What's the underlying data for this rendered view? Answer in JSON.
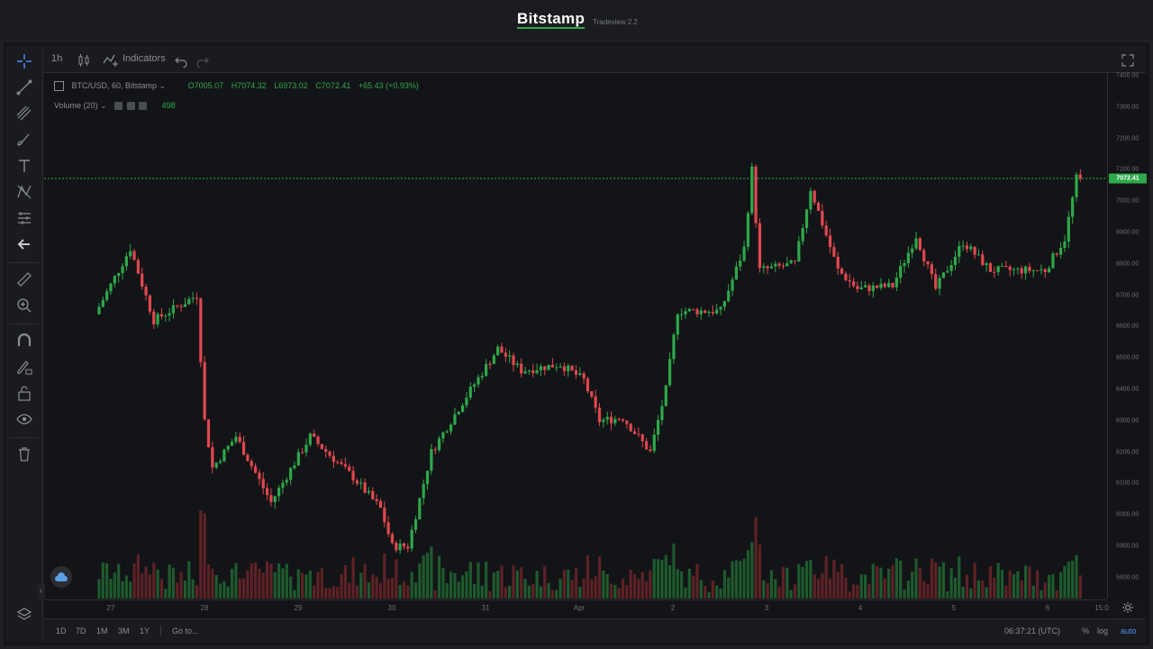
{
  "header": {
    "brand": "Bitstamp",
    "version": "Tradeview 2.2"
  },
  "toolbar": {
    "interval": "1h",
    "indicators_label": "Indicators"
  },
  "legend": {
    "symbol": "BTC/USD, 60, Bitstamp",
    "open": "O7005.07",
    "high": "H7074.32",
    "low": "L6973.02",
    "close": "C7072.41",
    "change": "+65.43 (+0.93%)"
  },
  "volume_legend": {
    "label": "Volume (20)",
    "value": "498"
  },
  "bottom": {
    "ranges": [
      "1D",
      "7D",
      "1M",
      "3M",
      "1Y"
    ],
    "goto": "Go to...",
    "clock": "06:37:21 (UTC)",
    "percent": "%",
    "log": "log",
    "auto": "auto"
  },
  "colors": {
    "up": "#2ea84a",
    "down": "#e0484f",
    "accent": "#2ea84a",
    "auto": "#4f8ff7"
  },
  "icons": [
    "crosshair-icon",
    "trend-line-icon",
    "fib-icon",
    "brush-icon",
    "text-icon",
    "pattern-icon",
    "projection-icon",
    "back-arrow-icon",
    "ruler-icon",
    "zoom-icon",
    "magnet-icon",
    "lock-draw-icon",
    "lock-icon",
    "eye-icon",
    "trash-icon",
    "layers-icon"
  ],
  "chart_data": {
    "type": "candlestick",
    "symbol": "BTC/USD",
    "interval": "60",
    "exchange": "Bitstamp",
    "ylim": [
      5720,
      7420
    ],
    "price_ticks": [
      7400,
      7300,
      7200,
      7100,
      7000,
      6900,
      6800,
      6700,
      6600,
      6500,
      6400,
      6300,
      6200,
      6100,
      6000,
      5900,
      5800
    ],
    "price_tick_labels": [
      "7400.00",
      "7300.00",
      "7200.00",
      "7100.00",
      "7000.00",
      "6900.00",
      "6800.00",
      "6700.00",
      "6600.00",
      "6500.00",
      "6400.00",
      "6300.00",
      "6200.00",
      "6100.00",
      "6000.00",
      "5900.00",
      "5800.00"
    ],
    "last_price": 7072.41,
    "last_price_label": "7072.41",
    "time_labels": [
      "27",
      "28",
      "29",
      "30",
      "31",
      "Apr",
      "2",
      "3",
      "4",
      "5",
      "6",
      "15:0"
    ],
    "key_points": [
      {
        "date": "Mar 26 21:00",
        "price": 6640
      },
      {
        "date": "Mar 27 06:00",
        "price": 6850
      },
      {
        "date": "Mar 27 12:00",
        "price": 6620
      },
      {
        "date": "Mar 27 23:00",
        "price": 6700
      },
      {
        "date": "Mar 28 01:00",
        "price": 6300
      },
      {
        "date": "Mar 28 03:00",
        "price": 6150
      },
      {
        "date": "Mar 28 09:00",
        "price": 6250
      },
      {
        "date": "Mar 28 18:00",
        "price": 6040
      },
      {
        "date": "Mar 29 04:00",
        "price": 6250
      },
      {
        "date": "Mar 29 15:00",
        "price": 6120
      },
      {
        "date": "Mar 29 22:00",
        "price": 6020
      },
      {
        "date": "Mar 30 01:00",
        "price": 5900
      },
      {
        "date": "Mar 30 05:00",
        "price": 5900
      },
      {
        "date": "Mar 30 11:00",
        "price": 6200
      },
      {
        "date": "Mar 30 19:00",
        "price": 6360
      },
      {
        "date": "Mar 31 04:00",
        "price": 6530
      },
      {
        "date": "Mar 31 10:00",
        "price": 6460
      },
      {
        "date": "Mar 31 20:00",
        "price": 6480
      },
      {
        "date": "Apr 1 02:00",
        "price": 6430
      },
      {
        "date": "Apr 1 06:00",
        "price": 6300
      },
      {
        "date": "Apr 1 12:00",
        "price": 6310
      },
      {
        "date": "Apr 1 19:00",
        "price": 6200
      },
      {
        "date": "Apr 1 23:00",
        "price": 6400
      },
      {
        "date": "Apr 2 02:00",
        "price": 6650
      },
      {
        "date": "Apr 2 13:00",
        "price": 6650
      },
      {
        "date": "Apr 2 19:00",
        "price": 6850
      },
      {
        "date": "Apr 2 21:00",
        "price": 7100
      },
      {
        "date": "Apr 2 23:00",
        "price": 6780
      },
      {
        "date": "Apr 3 08:00",
        "price": 6800
      },
      {
        "date": "Apr 3 12:00",
        "price": 7040
      },
      {
        "date": "Apr 3 19:00",
        "price": 6780
      },
      {
        "date": "Apr 4 00:00",
        "price": 6720
      },
      {
        "date": "Apr 4 09:00",
        "price": 6730
      },
      {
        "date": "Apr 4 15:00",
        "price": 6890
      },
      {
        "date": "Apr 4 20:00",
        "price": 6720
      },
      {
        "date": "Apr 5 03:00",
        "price": 6870
      },
      {
        "date": "Apr 5 10:00",
        "price": 6780
      },
      {
        "date": "Apr 5 18:00",
        "price": 6780
      },
      {
        "date": "Apr 6 00:00",
        "price": 6780
      },
      {
        "date": "Apr 6 05:00",
        "price": 6880
      },
      {
        "date": "Apr 6 08:00",
        "price": 7072.41
      }
    ],
    "volume_series": {
      "name": "Volume (20)",
      "last_value": 498
    },
    "grid": false,
    "legend": "top-left"
  }
}
